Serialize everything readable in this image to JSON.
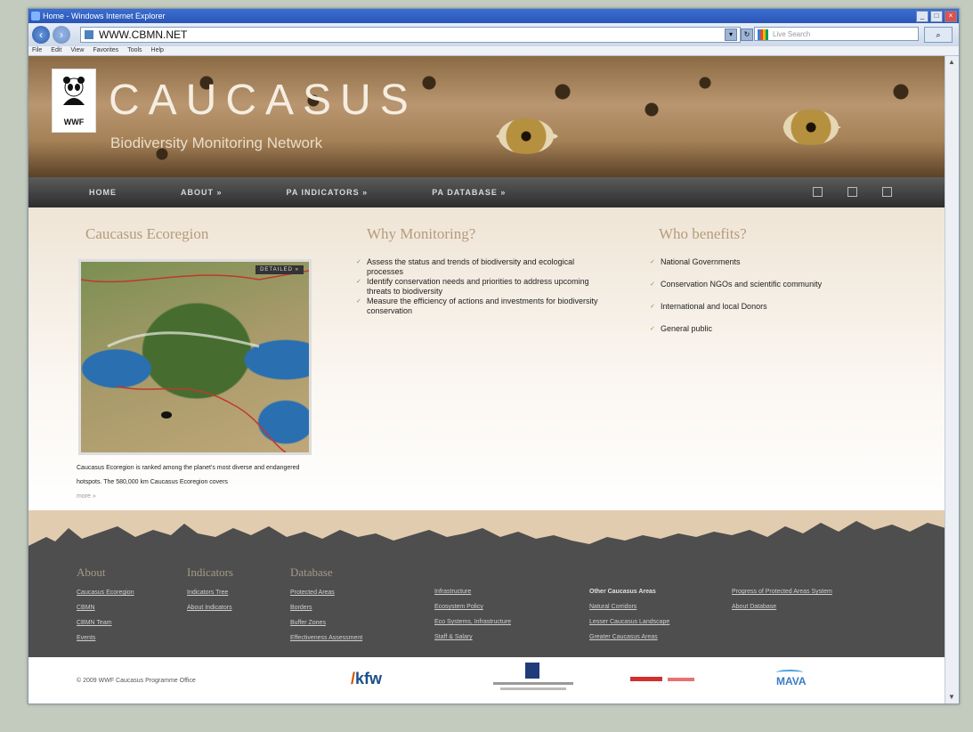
{
  "window": {
    "title": "Home - Windows Internet Explorer"
  },
  "browser": {
    "address": "WWW.CBMN.NET",
    "search_placeholder": "Live Search",
    "menu": [
      "File",
      "Edit",
      "View",
      "Favorites",
      "Tools",
      "Help"
    ]
  },
  "site": {
    "title": "CAUCASUS",
    "subtitle": "Biodiversity Monitoring Network",
    "logo_text": "WWF",
    "nav": [
      "HOME",
      "ABOUT »",
      "PA INDICATORS »",
      "PA DATABASE »"
    ]
  },
  "sections": {
    "ecoregion": {
      "heading": "Caucasus Ecoregion",
      "map_button": "DETAILED »",
      "caption": "Caucasus Ecoregion is ranked among the planet's most diverse and endangered hotspots. The 580,000 km Caucasus Ecoregion covers",
      "more": "more »"
    },
    "why": {
      "heading": "Why Monitoring?",
      "items": [
        "Assess the status and trends of biodiversity and ecological processes",
        "Identify conservation needs and priorities to address upcoming threats to biodiversity",
        "Measure the efficiency of actions and investments for biodiversity conservation"
      ]
    },
    "who": {
      "heading": "Who benefits?",
      "items": [
        "National Governments",
        "Conservation NGOs and scientific community",
        "International and local Donors",
        "General public"
      ]
    }
  },
  "footer": {
    "about": {
      "heading": "About",
      "links": [
        "Caucasus Ecoregion",
        "CBMN",
        "CBMN Team",
        "Events"
      ]
    },
    "indicators": {
      "heading": "Indicators",
      "links": [
        "Indicators Tree",
        "About Indicators"
      ]
    },
    "database": {
      "heading": "Database",
      "links": [
        "Protected Areas",
        "Borders",
        "Buffer Zones",
        "Effectiveness Assessment"
      ]
    },
    "col4": {
      "links": [
        "Infrastructure",
        "Ecosystem Policy",
        "Eco Systems, Infrastructure",
        "Staff & Salary"
      ]
    },
    "col5": {
      "heading": "Other Caucasus Areas",
      "links": [
        "Natural Corridors",
        "Lesser Caucasus Landscape",
        "Greater Caucasus Areas"
      ]
    },
    "col6": {
      "links": [
        "Progress of Protected Areas System",
        "About Database"
      ]
    }
  },
  "bottom": {
    "copyright": "© 2009 WWF Caucasus Programme Office",
    "logos": [
      "kfw",
      "MAVA"
    ]
  }
}
